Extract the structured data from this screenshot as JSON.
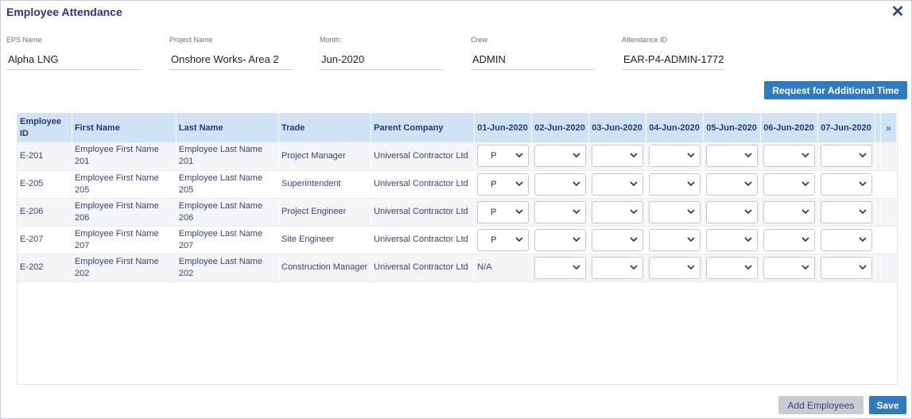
{
  "dialog": {
    "title": "Employee Attendance",
    "close_icon": "close-icon"
  },
  "fields": [
    {
      "label": "EPS Name",
      "value": "Alpha LNG"
    },
    {
      "label": "Project Name",
      "value": "Onshore  Works- Area 2"
    },
    {
      "label": "Month:",
      "value": "Jun-2020"
    },
    {
      "label": "Crew",
      "value": "ADMIN"
    },
    {
      "label": "Attendance ID",
      "value": "EAR-P4-ADMIN-1772"
    }
  ],
  "buttons": {
    "request_time": "Request for Additional Time",
    "add_employees": "Add Employees",
    "save": "Save"
  },
  "colors": {
    "accent": "#2e7bbf",
    "header_bg": "#cfe3f6",
    "title": "#2f3380"
  },
  "table": {
    "headers": {
      "employee_id": "Employee ID",
      "first_name": "First Name",
      "last_name": "Last Name",
      "trade": "Trade",
      "parent_company": "Parent Company",
      "more": "»"
    },
    "dates": [
      "01-Jun-2020",
      "02-Jun-2020",
      "03-Jun-2020",
      "04-Jun-2020",
      "05-Jun-2020",
      "06-Jun-2020",
      "07-Jun-2020"
    ],
    "rows": [
      {
        "id": "E-201",
        "first": "Employee First Name 201",
        "last": "Employee Last Name 201",
        "trade": "Project Manager",
        "company": "Universal Contractor Ltd",
        "day1": "P",
        "day1_na": false
      },
      {
        "id": "E-205",
        "first": "Employee First Name 205",
        "last": "Employee Last Name 205",
        "trade": "Superintendent",
        "company": "Universal Contractor Ltd",
        "day1": "P",
        "day1_na": false
      },
      {
        "id": "E-206",
        "first": "Employee First Name 206",
        "last": "Employee Last Name 206",
        "trade": "Project Engineer",
        "company": "Universal Contractor Ltd",
        "day1": "P",
        "day1_na": false
      },
      {
        "id": "E-207",
        "first": "Employee First Name 207",
        "last": "Employee Last Name 207",
        "trade": "Site Engineer",
        "company": "Universal Contractor Ltd",
        "day1": "P",
        "day1_na": false
      },
      {
        "id": "E-202",
        "first": "Employee First Name 202",
        "last": "Employee Last Name 202",
        "trade": "Construction Manager",
        "company": "Universal Contractor Ltd",
        "day1": "N/A",
        "day1_na": true
      }
    ]
  }
}
